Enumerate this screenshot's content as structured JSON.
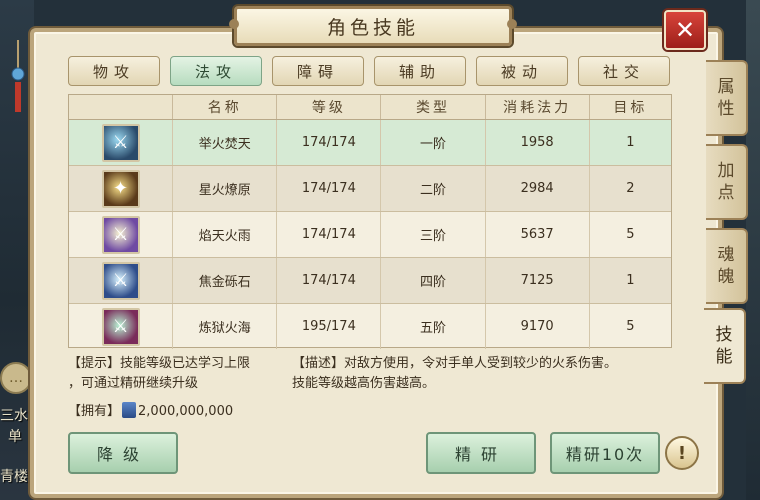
{
  "window": {
    "title": "角色技能",
    "close_label": "✕"
  },
  "tabs": [
    {
      "label": "物攻",
      "active": false
    },
    {
      "label": "法攻",
      "active": true
    },
    {
      "label": "障碍",
      "active": false
    },
    {
      "label": "辅助",
      "active": false
    },
    {
      "label": "被动",
      "active": false
    },
    {
      "label": "社交",
      "active": false
    }
  ],
  "side_tabs": [
    {
      "label": "属\n性",
      "active": false
    },
    {
      "label": "加\n点",
      "active": false
    },
    {
      "label": "魂\n魄",
      "active": false
    },
    {
      "label": "技\n能",
      "active": true
    }
  ],
  "table": {
    "headers": [
      "",
      "名称",
      "等级",
      "类型",
      "消耗法力",
      "目标"
    ],
    "rows": [
      {
        "icon": "fire-sword-icon",
        "name": "举火焚天",
        "level": "174/174",
        "type": "一阶",
        "cost": "1958",
        "target": "1",
        "selected": true
      },
      {
        "icon": "star-fire-icon",
        "name": "星火燎原",
        "level": "174/174",
        "type": "二阶",
        "cost": "2984",
        "target": "2",
        "selected": false
      },
      {
        "icon": "flame-rain-icon",
        "name": "焰天火雨",
        "level": "174/174",
        "type": "三阶",
        "cost": "5637",
        "target": "5",
        "selected": false
      },
      {
        "icon": "gold-stone-icon",
        "name": "焦金砾石",
        "level": "174/174",
        "type": "四阶",
        "cost": "7125",
        "target": "1",
        "selected": false
      },
      {
        "icon": "hell-fire-icon",
        "name": "炼狱火海",
        "level": "195/174",
        "type": "五阶",
        "cost": "9170",
        "target": "5",
        "selected": false
      }
    ]
  },
  "tip": {
    "line1": "【提示】技能等级已达学习上限",
    "line2": "，可通过精研继续升级"
  },
  "description": {
    "line1": "【描述】对敌方使用，令对手单人受到较少的火系伤害。",
    "line2": "技能等级越高伤害越高。"
  },
  "owned": {
    "label": "【拥有】",
    "amount": "2,000,000,000"
  },
  "buttons": {
    "downgrade": "降级",
    "refine": "精研",
    "refine10": "精研10次",
    "alert": "!"
  },
  "background": {
    "left_text_1": "三水",
    "left_text_2": "单",
    "left_text_3": "青楼"
  },
  "colors": {
    "panel": "#efe8d3",
    "active_tab": "#b7dcbf",
    "close": "#c3352c",
    "selected_row": "#d6ead4"
  }
}
